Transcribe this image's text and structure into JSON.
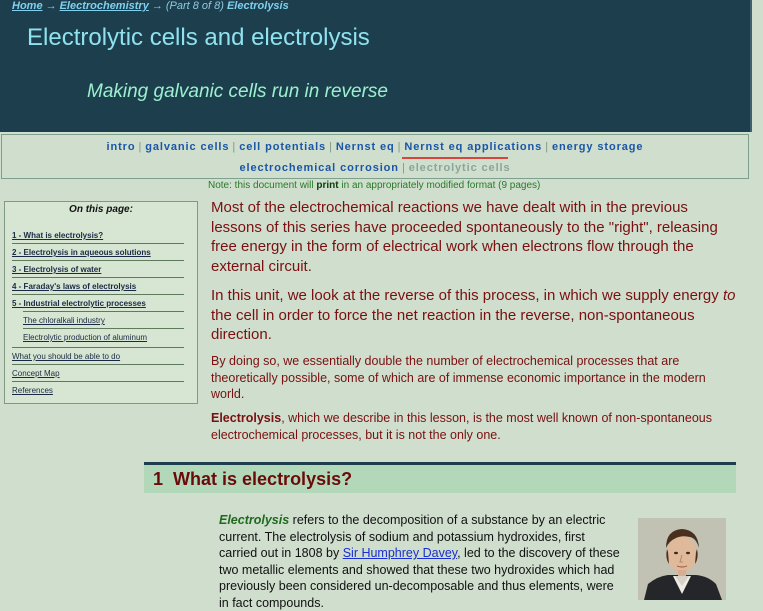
{
  "breadcrumb": {
    "home": "Home",
    "arrow": "→",
    "section": "Electrochemistry",
    "part": "(Part 8 of 8)",
    "current": "Electrolysis"
  },
  "header": {
    "title": "Electrolytic cells and electrolysis",
    "subtitle": "Making galvanic cells run in reverse"
  },
  "nav": {
    "line1": [
      "intro",
      "galvanic cells",
      "cell potentials",
      "Nernst eq",
      "Nernst eq applications",
      "energy storage"
    ],
    "line2": [
      "electrochemical corrosion",
      "electrolytic cells"
    ],
    "separator": "|",
    "active": "electrolytic cells"
  },
  "print_note": {
    "prefix": "Note: this document will",
    "bold": "print",
    "suffix": "in an appropriately modified format (9 pages)"
  },
  "toc": {
    "title": "On this page:",
    "items": [
      "1 - What is electrolysis?",
      "2 - Electrolysis in aqueous solutions",
      "3 - Electrolysis of water",
      "4 - Faraday's laws of electrolysis",
      "5 - Industrial electrolytic processes",
      "The chloralkali industry",
      "Electrolytic production of aluminum",
      "What you should be able to do",
      "Concept Map",
      "References"
    ]
  },
  "intro": {
    "p1": "Most of the electrochemical reactions we have dealt with in the previous lessons of this series have proceeded spontaneously to the \"right\", releasing free energy in the form of electrical work when electrons flow through the external circuit.",
    "p2_a": "In this unit, we look at the reverse of this process, in which we supply energy",
    "p2_em": "to",
    "p2_b": "the cell in order to force the net reaction in the reverse, non-spontaneous direction.",
    "p3": "By doing so, we essentially double the number of electrochemical processes that are theoretically possible, some of which are of immense economic importance in the modern world.",
    "p4_bold": "Electrolysis",
    "p4_rest": ", which we describe in this lesson, is the most well known of non-spontaneous electrochemical processes, but it is not the only one."
  },
  "section1": {
    "number": "1",
    "title": "What is electrolysis?",
    "term": "Electrolysis",
    "text_a": "refers to the decomposition of a substance by an electric current. The electrolysis of sodium and potassium hydroxides, first carried out in 1808 by",
    "link": "Sir Humphrey Davey",
    "text_b": ", led to the discovery of these two metallic elements and showed that these two hydroxides which had previously been considered un-decomposable and thus elements, were in fact compounds."
  },
  "colors": {
    "header_bg": "#1d3f4d",
    "page_bg": "#cfdecd",
    "title_cyan": "#8fe2ef",
    "subtitle_green": "#9cf0cf",
    "nav_link": "#1a55a8",
    "intro_text": "#7a1010",
    "section_bar": "#b3d8b9",
    "section_title": "#6a0b0b",
    "term_green": "#1e6a1e",
    "accent_red": "#d8453d"
  },
  "icons": {
    "portrait": "portrait-image"
  }
}
